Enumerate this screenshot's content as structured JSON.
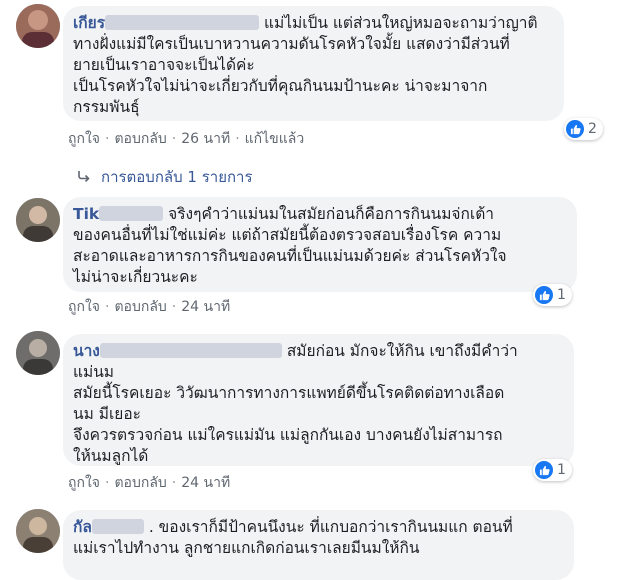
{
  "comments": [
    {
      "name": "เกียร",
      "lines": [
        "แม่ไม่เป็น แต่ส่วนใหญ่หมอจะถามว่าญาติ",
        "ทางฝั่งแม่มีใครเป็นเบาหวานความดันโรคหัวใจมั้ย แสดงว่ามีส่วนที่",
        "ยายเป็นเราอาจจะเป็นได้ค่ะ",
        "เป็นโรคหัวใจไม่น่าจะเกี่ยวกับที่คุณกินนมป้านะคะ น่าจะมาจาก",
        "กรรมพันธุ์"
      ],
      "like": "ถูกใจ",
      "reply": "ตอบกลับ",
      "time": "26 นาที",
      "edited": "แก้ไขแล้ว",
      "reactions": "2"
    },
    {
      "name": "Tik",
      "lines": [
        "จริงๆคำว่าแม่นมในสมัยก่อนก็คือการกินนมจ่กเต้า",
        "ของคนอื่นที่ไม่ใช่แม่ค่ะ แต่ถ้าสมัยนี้ต้องตรวจสอบเรื่องโรค ความ",
        "สะอาดและอาหารการกินของคนที่เป็นแม่นมด้วยค่ะ ส่วนโรคหัวใจ",
        "ไม่น่าจะเกี่ยวนะคะ"
      ],
      "like": "ถูกใจ",
      "reply": "ตอบกลับ",
      "time": "24 นาที",
      "reactions": "1"
    },
    {
      "name": "นาง",
      "lines": [
        "สมัยก่อน มักจะให้กิน เขาถึงมีคำว่า",
        "แม่นม",
        "สมัยนี้โรคเยอะ วิวัฒนาการทางการแพทย์ดีขึ้นโรคติดต่อทางเลือด",
        "นม มีเยอะ",
        "จึงควรตรวจก่อน แม่ใครแม่มัน แม่ลูกกันเอง บางคนยังไม่สามารถ",
        "ให้นมลูกได้"
      ],
      "like": "ถูกใจ",
      "reply": "ตอบกลับ",
      "time": "24 นาที",
      "reactions": "1"
    },
    {
      "name": "กัล",
      "lines": [
        ". ของเราก็มีป้าคนนึงนะ ที่แกบอกว่าเรากินนมแก ตอนที่",
        "แม่เราไปทำงาน ลูกชายแกเกิดก่อนเราเลยมีนมให้กิน"
      ]
    }
  ],
  "replies_link": "การตอบกลับ 1 รายการ",
  "icons": [
    "like-icon",
    "reply-arrow-icon"
  ],
  "colors": {
    "name": "#385898",
    "bubble": "#f2f3f5",
    "like": "#1877f2"
  }
}
